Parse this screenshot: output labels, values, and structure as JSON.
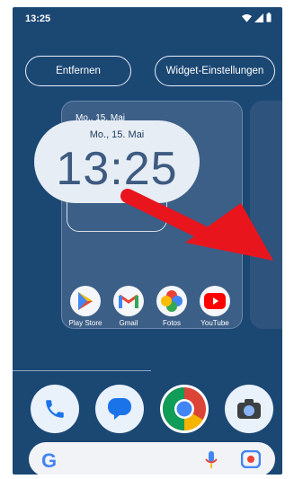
{
  "status": {
    "time": "13:25"
  },
  "actions": {
    "remove_label": "Entfernen",
    "widget_settings_label": "Widget-Einstellungen"
  },
  "widget": {
    "small_date": "Mo., 15. Mai",
    "large_date": "Mo., 15. Mai",
    "large_time": "13:25"
  },
  "apps": [
    {
      "label": "Play Store",
      "icon": "play-store-icon"
    },
    {
      "label": "Gmail",
      "icon": "gmail-icon"
    },
    {
      "label": "Fotos",
      "icon": "photos-icon"
    },
    {
      "label": "YouTube",
      "icon": "youtube-icon"
    }
  ],
  "dock": [
    {
      "icon": "phone-icon"
    },
    {
      "icon": "messages-icon"
    },
    {
      "icon": "chrome-icon"
    },
    {
      "icon": "camera-icon"
    }
  ],
  "search": {
    "logo": "G",
    "mic": "mic-icon",
    "lens": "lens-icon"
  },
  "colors": {
    "background": "#1b4773",
    "arrow": "#e8151d",
    "panel": "#3c5f87",
    "bubble": "#e6edf5"
  }
}
